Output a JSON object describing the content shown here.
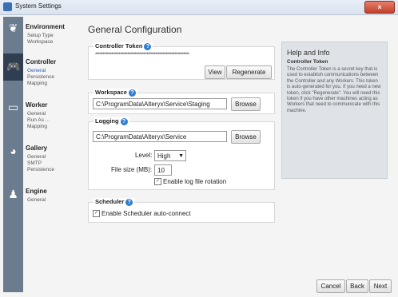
{
  "window": {
    "title": "System Settings",
    "close_label": "×"
  },
  "sidebar": {
    "sections": [
      {
        "title": "Environment",
        "icon": "sprout-icon",
        "items": [
          "Setup Type",
          "Workspace"
        ]
      },
      {
        "title": "Controller",
        "icon": "gamepad-icon",
        "items": [
          "General",
          "Persistence",
          "Mapping"
        ]
      },
      {
        "title": "Worker",
        "icon": "monitor-icon",
        "items": [
          "General",
          "Run As ...",
          "Mapping"
        ]
      },
      {
        "title": "Gallery",
        "icon": "palette-icon",
        "items": [
          "General",
          "SMTP",
          "Persistence"
        ]
      },
      {
        "title": "Engine",
        "icon": "engine-icon",
        "items": [
          "General"
        ]
      }
    ],
    "selected": "Controller > General"
  },
  "main": {
    "title": "General Configuration",
    "controller_token": {
      "label": "Controller Token",
      "value": "****************************************************************",
      "view_label": "View",
      "regenerate_label": "Regenerate"
    },
    "workspace": {
      "label": "Workspace",
      "path": "C:\\ProgramData\\Alteryx\\Service\\Staging",
      "browse_label": "Browse"
    },
    "logging": {
      "label": "Logging",
      "path": "C:\\ProgramData\\Alteryx\\Service",
      "browse_label": "Browse",
      "level_label": "Level:",
      "level_value": "High",
      "filesize_label": "File size (MB):",
      "filesize_value": "10",
      "rotation_label": "Enable log file rotation",
      "rotation_checked": true
    },
    "scheduler": {
      "label": "Scheduler",
      "autoconnect_label": "Enable Scheduler auto-connect",
      "autoconnect_checked": true
    }
  },
  "help": {
    "title": "Help and Info",
    "subtitle": "Controller Token",
    "body": "The Controller Token is a secret key that is used to establish communications between the Controller and any Workers. This token is auto-generated for you. If you need a new token, click \"Regenerate\". You will need this token if you have other machines acting as Workers that need to communicate with this machine."
  },
  "footer": {
    "cancel_label": "Cancel",
    "back_label": "Back",
    "next_label": "Next"
  },
  "colors": {
    "accent": "#2f7dd1",
    "rail": "#6b7c8f",
    "rail_active": "#2f3e50",
    "close": "#c2402a"
  }
}
